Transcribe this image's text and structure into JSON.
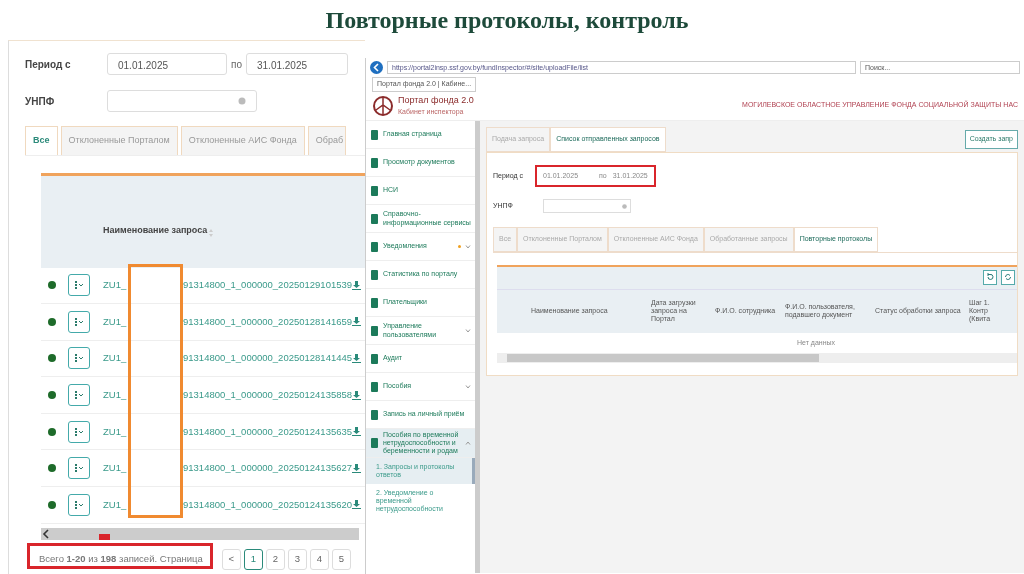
{
  "slide_title": "Повторные протоколы, контроль",
  "left_screen": {
    "period": {
      "label": "Период с",
      "from": "01.01.2025",
      "sep": "по",
      "to": "31.01.2025"
    },
    "unpf": {
      "label": "УНПФ"
    },
    "tabs": [
      {
        "label": "Все",
        "selected": true
      },
      {
        "label": "Отклоненные Порталом",
        "selected": false
      },
      {
        "label": "Отклоненные АИС Фонда",
        "selected": false
      },
      {
        "label": "Обраб",
        "selected": false
      }
    ],
    "table": {
      "column": "Наименование запроса",
      "rows": [
        {
          "prefix": "ZU1_",
          "name": "91314800_1_000000_20250129101539"
        },
        {
          "prefix": "ZU1_",
          "name": "91314800_1_000000_20250128141659"
        },
        {
          "prefix": "ZU1_",
          "name": "91314800_1_000000_20250128141445"
        },
        {
          "prefix": "ZU1_",
          "name": "91314800_1_000000_20250124135858"
        },
        {
          "prefix": "ZU1_",
          "name": "91314800_1_000000_20250124135635"
        },
        {
          "prefix": "ZU1_",
          "name": "91314800_1_000000_20250124135627"
        },
        {
          "prefix": "ZU1_",
          "name": "91314800_1_000000_20250124135620"
        }
      ]
    },
    "summary": "Всего **1-20** из **198** записей. Страница",
    "prev": "<",
    "pages": [
      {
        "label": "1",
        "selected": true
      },
      {
        "label": "2",
        "selected": false
      },
      {
        "label": "3",
        "selected": false
      },
      {
        "label": "4",
        "selected": false
      },
      {
        "label": "5",
        "selected": false
      }
    ]
  },
  "right_screen": {
    "url": "https://portal2insp.ssf.gov.by/fundInspector/#/site/uploadFile/list",
    "search": "Поиск...",
    "browser_tab": "Портал фонда 2.0 | Кабине...",
    "portal_title": "Портал фонда 2.0",
    "portal_subtitle": "Кабинет инспектора",
    "org": "МОГИЛЕВСКОЕ ОБЛАСТНОЕ УПРАВЛЕНИЕ ФОНДА СОЦИАЛЬНОЙ ЗАЩИТЫ НАС",
    "sidebar": [
      {
        "label": "Главная страница",
        "notify": false
      },
      {
        "label": "Просмотр документов",
        "notify": false
      },
      {
        "label": "НСИ",
        "notify": false
      },
      {
        "label": "Справочно-информационные сервисы",
        "notify": false
      },
      {
        "label": "Уведомления",
        "notify": true,
        "expanded": false
      },
      {
        "label": "Статистика по порталу",
        "notify": false
      },
      {
        "label": "Плательщики",
        "notify": false
      },
      {
        "label": "Управление пользователями",
        "notify": false,
        "expanded": false
      },
      {
        "label": "Аудит",
        "notify": false
      },
      {
        "label": "Пособия",
        "notify": false,
        "expanded": false
      },
      {
        "label": "Запись на личный приём",
        "notify": false
      },
      {
        "label": "Пособия по временной нетрудоспособности и беременности и родам",
        "notify": false,
        "expanded": true,
        "children": [
          {
            "label": "1. Запросы и протоколы ответов",
            "selected": true
          },
          {
            "label": "2. Уведомление о временной нетрудоспособности",
            "selected": false
          }
        ]
      }
    ],
    "top_tabs": [
      {
        "label": "Подача запроса",
        "selected": false
      },
      {
        "label": "Список отправленных запросов",
        "selected": true
      }
    ],
    "create_button": "Создать запр",
    "period": {
      "label": "Период с",
      "from": "01.01.2025",
      "sep": "по",
      "to": "31.01.2025"
    },
    "unpf": {
      "label": "УНПФ"
    },
    "tabs": [
      {
        "label": "Все",
        "selected": false
      },
      {
        "label": "Отклоненные Порталом",
        "selected": false
      },
      {
        "label": "Отклоненные АИС Фонда",
        "selected": false
      },
      {
        "label": "Обработанные запросы",
        "selected": false
      },
      {
        "label": "Повторные протоколы",
        "selected": true
      }
    ],
    "columns": [
      "Наименование запроса",
      "Дата загрузки запроса на Портал",
      "Ф.И.О. сотрудника",
      "Ф.И.О. пользователя, подавшего документ",
      "Статус обработки запроса",
      "Шаг 1. Контр (Квита"
    ],
    "empty": "Нет данных"
  }
}
